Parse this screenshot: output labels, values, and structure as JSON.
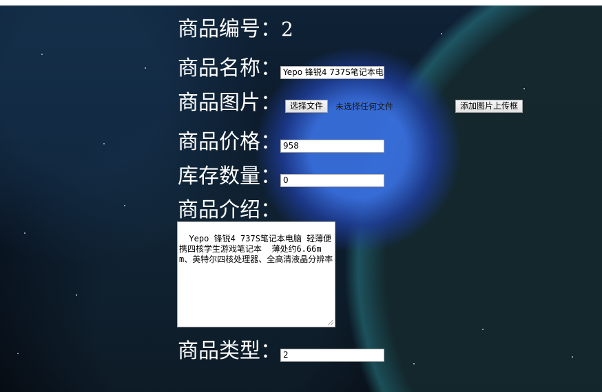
{
  "form": {
    "id_label": "商品编号：",
    "id_value": "2",
    "name_label": "商品名称：",
    "name_value": "Yepo 锋锐4 737S笔记本电",
    "image_label": "商品图片：",
    "choose_file_label": "选择文件",
    "no_file_text": "未选择任何文件",
    "add_upload_label": "添加图片上传框",
    "price_label": "商品价格：",
    "price_value": "958",
    "stock_label": "库存数量：",
    "stock_value": "0",
    "intro_label": "商品介绍：",
    "intro_value": "Yepo 锋锐4 737S笔记本电脑 轻薄便携四核学生游戏笔记本  薄处约6.66mm、英特尔四核处理器、全高清液晶分辨率",
    "type_label": "商品类型：",
    "type_value": "2"
  }
}
